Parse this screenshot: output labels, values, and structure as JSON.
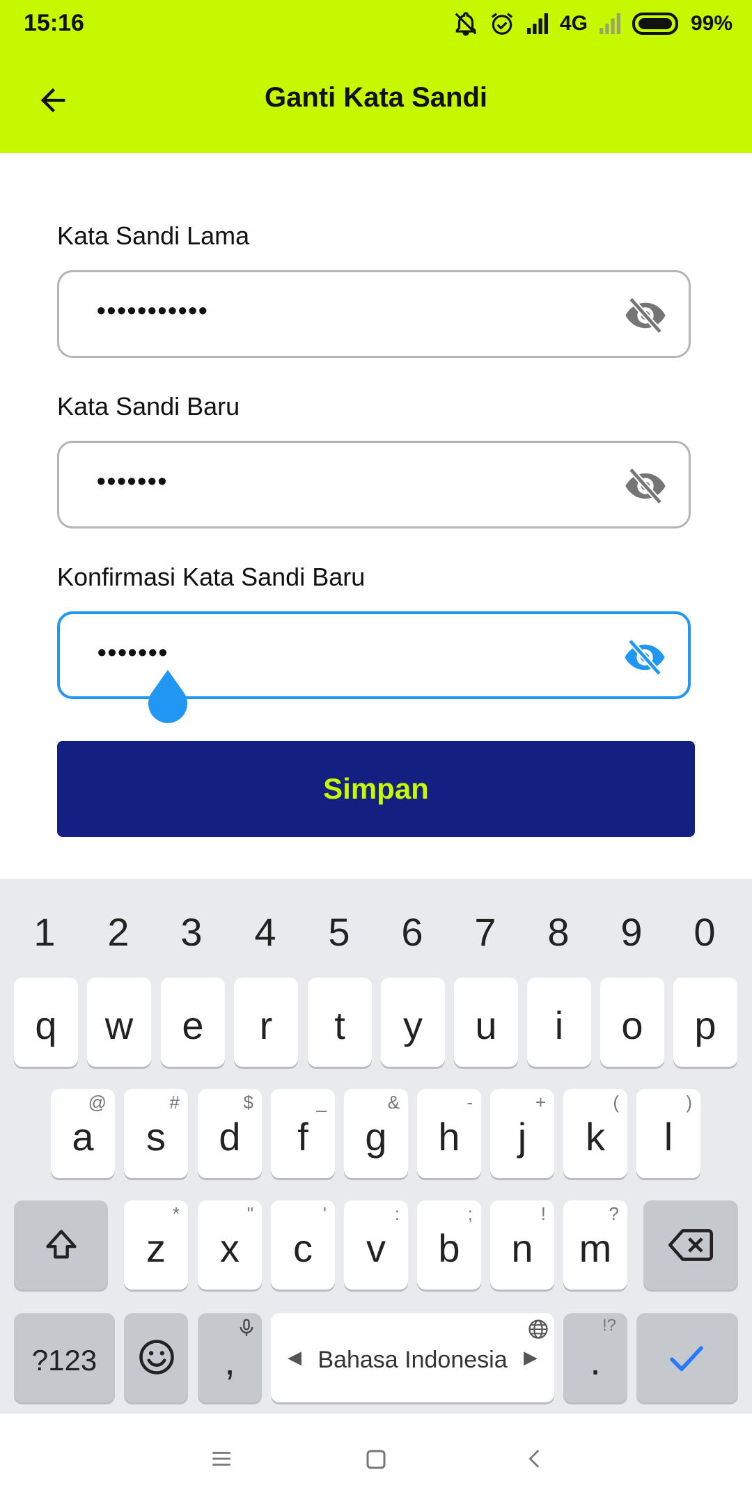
{
  "status_bar": {
    "time": "15:16",
    "network": "4G",
    "battery": "99%",
    "icons": [
      "mute-icon",
      "alarm-icon",
      "signal-icon",
      "signal-weak-icon",
      "battery-icon"
    ]
  },
  "app_bar": {
    "title": "Ganti Kata Sandi",
    "back_icon": "arrow-back-icon"
  },
  "form": {
    "old_password": {
      "label": "Kata Sandi Lama",
      "value": "•••••••••••"
    },
    "new_password": {
      "label": "Kata Sandi Baru",
      "value": "•••••••"
    },
    "confirm_password": {
      "label": "Konfirmasi Kata Sandi Baru",
      "value": "•••••••"
    },
    "save_label": "Simpan"
  },
  "keyboard": {
    "numbers": [
      "1",
      "2",
      "3",
      "4",
      "5",
      "6",
      "7",
      "8",
      "9",
      "0"
    ],
    "row1": [
      "q",
      "w",
      "e",
      "r",
      "t",
      "y",
      "u",
      "i",
      "o",
      "p"
    ],
    "row2": [
      {
        "k": "a",
        "h": "@"
      },
      {
        "k": "s",
        "h": "#"
      },
      {
        "k": "d",
        "h": "$"
      },
      {
        "k": "f",
        "h": "_"
      },
      {
        "k": "g",
        "h": "&"
      },
      {
        "k": "h",
        "h": "-"
      },
      {
        "k": "j",
        "h": "+"
      },
      {
        "k": "k",
        "h": "("
      },
      {
        "k": "l",
        "h": ")"
      }
    ],
    "row3": [
      {
        "k": "z",
        "h": "*"
      },
      {
        "k": "x",
        "h": "\""
      },
      {
        "k": "c",
        "h": "'"
      },
      {
        "k": "v",
        "h": ":"
      },
      {
        "k": "b",
        "h": ";"
      },
      {
        "k": "n",
        "h": "!"
      },
      {
        "k": "m",
        "h": "?"
      }
    ],
    "symbols_label": "?123",
    "comma_label": ",",
    "space_label": "Bahasa Indonesia",
    "period_label": ".",
    "period_hint": "!?"
  },
  "colors": {
    "accent": "#c6f800",
    "primary_button": "#141f82",
    "focus": "#2196f3"
  }
}
